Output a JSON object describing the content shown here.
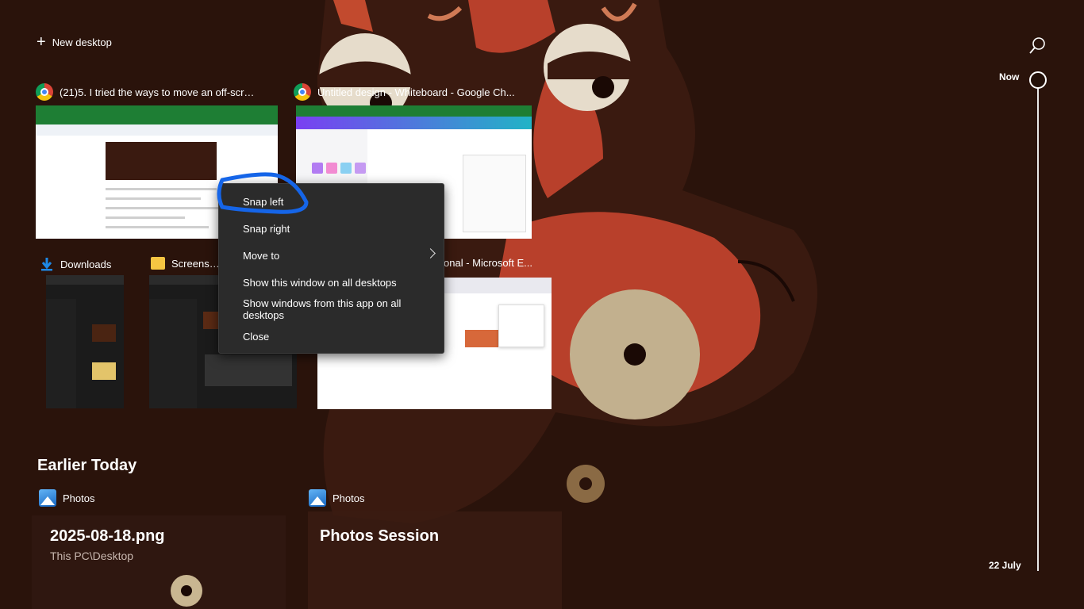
{
  "top": {
    "new_desktop": "New desktop"
  },
  "timeline": {
    "now": "Now",
    "date": "22 July"
  },
  "windows": [
    {
      "title": "(21)5. I tried the ways to move an off-scree...",
      "app_icon": "chrome-icon"
    },
    {
      "title": "Untitled design - Whiteboard - Google Ch...",
      "app_icon": "chrome-icon"
    },
    {
      "title": "Downloads",
      "app_icon": "download-folder-icon"
    },
    {
      "title": "Screenshots",
      "app_icon": "folder-icon"
    },
    {
      "title": "onal - Microsoft E...",
      "app_icon": "edge-icon"
    }
  ],
  "context_menu": {
    "items": [
      "Snap left",
      "Snap right",
      "Move to",
      "Show this window on all desktops",
      "Show windows from this app on all desktops",
      "Close"
    ]
  },
  "earlier": {
    "heading": "Earlier Today",
    "activities": [
      {
        "app": "Photos",
        "title": "2025-08-18.png",
        "subtitle": "This PC\\Desktop"
      },
      {
        "app": "Photos",
        "title": "Photos Session",
        "subtitle": ""
      }
    ]
  },
  "colors": {
    "annotation": "#1565e8",
    "menu_bg": "#2b2b2b",
    "wallpaper_red": "#b8402b"
  }
}
